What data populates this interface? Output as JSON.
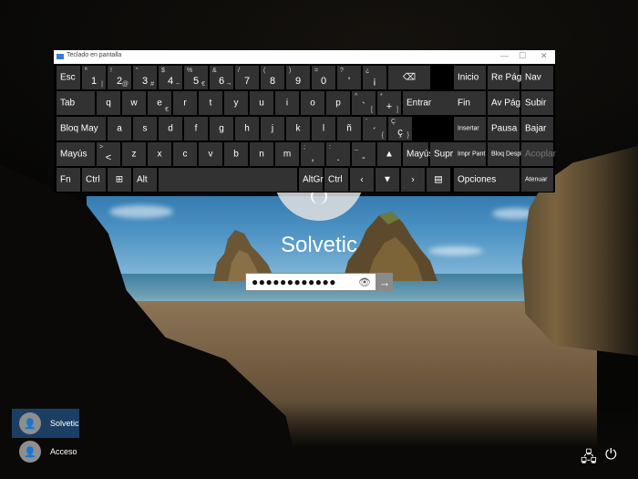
{
  "osk": {
    "title": "Teclado en pantalla",
    "rows": [
      [
        {
          "label": "Esc"
        },
        {
          "sup": "ª",
          "main": "1",
          "sub": "|"
        },
        {
          "sup": "!",
          "main": "2",
          "sub": "@"
        },
        {
          "sup": "\"",
          "main": "3",
          "sub": "#"
        },
        {
          "sup": "$",
          "main": "4",
          "sub": "~"
        },
        {
          "sup": "%",
          "main": "5",
          "sub": "€"
        },
        {
          "sup": "&",
          "main": "6",
          "sub": "¬"
        },
        {
          "sup": "/",
          "main": "7"
        },
        {
          "sup": "(",
          "main": "8"
        },
        {
          "sup": ")",
          "main": "9"
        },
        {
          "sup": "=",
          "main": "0"
        },
        {
          "sup": "?",
          "main": "'"
        },
        {
          "sup": "¿",
          "main": "¡"
        },
        {
          "label": "⌫",
          "icon": "backspace-icon"
        }
      ],
      [
        {
          "label": "Tab"
        },
        {
          "label": "q"
        },
        {
          "label": "w"
        },
        {
          "label": "e",
          "sub": "€"
        },
        {
          "label": "r"
        },
        {
          "label": "t"
        },
        {
          "label": "y"
        },
        {
          "label": "u"
        },
        {
          "label": "i"
        },
        {
          "label": "o"
        },
        {
          "label": "p"
        },
        {
          "sup": "^",
          "main": "`",
          "sub": "["
        },
        {
          "sup": "*",
          "main": "+",
          "sub": "]"
        },
        {
          "label": "Entrar"
        }
      ],
      [
        {
          "label": "Bloq May"
        },
        {
          "label": "a"
        },
        {
          "label": "s"
        },
        {
          "label": "d"
        },
        {
          "label": "f"
        },
        {
          "label": "g"
        },
        {
          "label": "h"
        },
        {
          "label": "j"
        },
        {
          "label": "k"
        },
        {
          "label": "l"
        },
        {
          "label": "ñ"
        },
        {
          "sup": "¨",
          "main": "´",
          "sub": "{"
        },
        {
          "sup": "Ç",
          "main": "ç",
          "sub": "}"
        }
      ],
      [
        {
          "label": "Mayús"
        },
        {
          "sup": ">",
          "main": "<"
        },
        {
          "label": "z"
        },
        {
          "label": "x"
        },
        {
          "label": "c"
        },
        {
          "label": "v"
        },
        {
          "label": "b"
        },
        {
          "label": "n"
        },
        {
          "label": "m"
        },
        {
          "sup": ";",
          "main": ","
        },
        {
          "sup": ":",
          "main": "."
        },
        {
          "sup": "_",
          "main": "-"
        },
        {
          "label": "▲",
          "icon": "arrow-up-icon"
        },
        {
          "label": "Mayús"
        },
        {
          "label": "Supr"
        }
      ],
      [
        {
          "label": "Fn"
        },
        {
          "label": "Ctrl"
        },
        {
          "label": "⊞",
          "icon": "windows-icon"
        },
        {
          "label": "Alt"
        },
        {
          "label": ""
        },
        {
          "label": "AltGr"
        },
        {
          "label": "Ctrl"
        },
        {
          "label": "‹",
          "icon": "arrow-left-icon"
        },
        {
          "label": "▼",
          "icon": "arrow-down-icon"
        },
        {
          "label": "›",
          "icon": "arrow-right-icon"
        },
        {
          "label": "▤",
          "icon": "menu-icon"
        }
      ]
    ],
    "right": [
      [
        {
          "label": "Inicio"
        },
        {
          "label": "Re Pág"
        },
        {
          "label": "Nav"
        }
      ],
      [
        {
          "label": "Fin"
        },
        {
          "label": "Av Pág"
        },
        {
          "label": "Subir"
        }
      ],
      [
        {
          "label": "Insertar"
        },
        {
          "label": "Pausa"
        },
        {
          "label": "Bajar"
        }
      ],
      [
        {
          "label": "Impr Pant"
        },
        {
          "label": "Bloq Despl"
        },
        {
          "label": "Acoplar"
        }
      ],
      [
        {
          "label": "Opciones"
        },
        {
          "label": "Atenuar"
        }
      ]
    ]
  },
  "login": {
    "username": "Solvetic",
    "password_mask": "●●●●●●●●●●●●",
    "reveal_icon": "eye-icon",
    "submit_icon": "arrow-right-icon"
  },
  "users": [
    {
      "name": "Solvetic",
      "selected": true
    },
    {
      "name": "Acceso",
      "selected": false
    }
  ],
  "tray": {
    "network_icon": "network-icon",
    "power_icon": "power-icon"
  },
  "colors": {
    "key_bg": "#323232",
    "osk_bg": "#000000",
    "selected_user_bg": "#1d3e63"
  }
}
